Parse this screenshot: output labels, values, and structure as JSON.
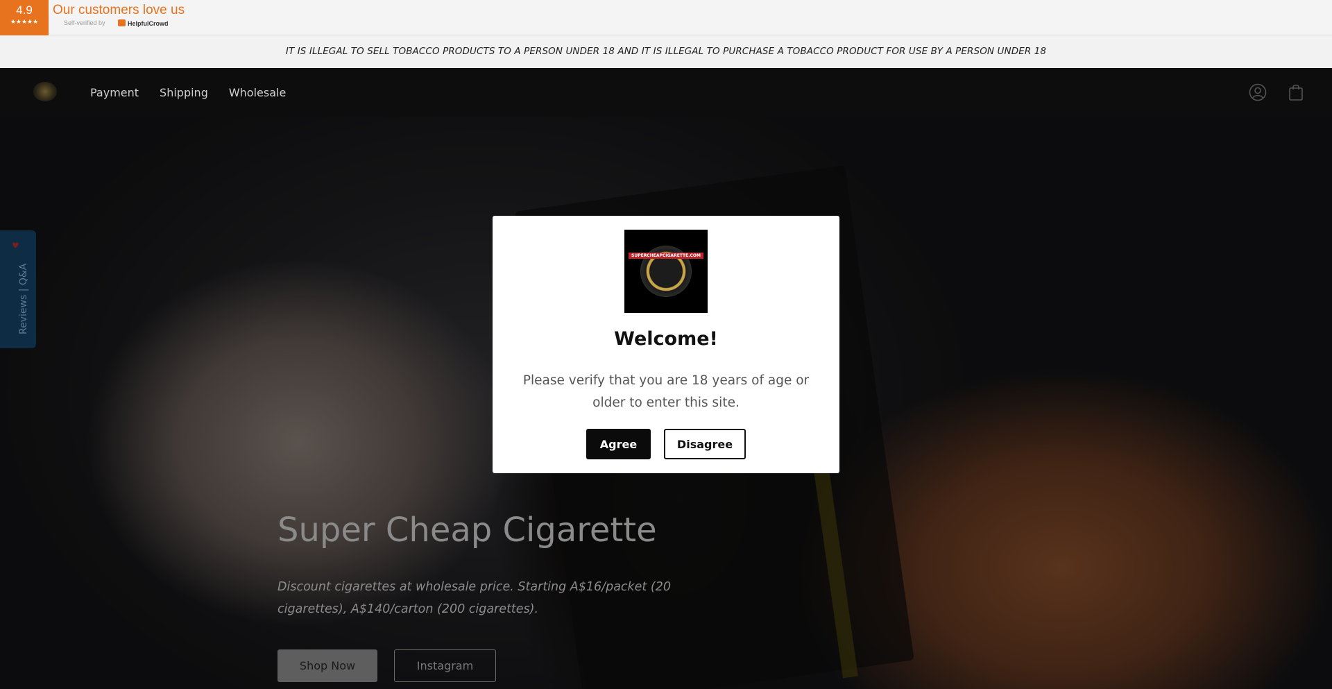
{
  "review_bar": {
    "rating": "4.9",
    "stars": "★★★★★",
    "title": "Our customers love us",
    "verified_text": "Self-verified by",
    "brand": "HelpfulCrowd"
  },
  "legal_banner": {
    "text": "IT IS ILLEGAL TO SELL TOBACCO PRODUCTS TO A PERSON UNDER 18 AND IT IS ILLEGAL TO PURCHASE A TOBACCO PRODUCT FOR USE BY A PERSON UNDER 18"
  },
  "header": {
    "nav": [
      {
        "label": "Payment"
      },
      {
        "label": "Shipping"
      },
      {
        "label": "Wholesale"
      }
    ],
    "icons": [
      "account-icon",
      "cart-icon"
    ]
  },
  "side_tab": {
    "label": "Reviews | Q&A",
    "icon": "heart-icon"
  },
  "hero": {
    "title": "Super Cheap Cigarette",
    "description": "Discount cigarettes at wholesale price. Starting A$16/packet (20 cigarettes), A$140/carton (200 cigarettes).",
    "shop_button": "Shop Now",
    "instagram_button": "Instagram"
  },
  "modal": {
    "logo_text": "SUPERCHEAPCIGARETTE.COM",
    "title": "Welcome!",
    "text": "Please verify that you are 18 years of age or older to enter this site.",
    "agree": "Agree",
    "disagree": "Disagree"
  },
  "colors": {
    "accent": "#e8731f",
    "header_bg": "#0d0d0d",
    "side_tab_bg": "#0e2c44"
  }
}
